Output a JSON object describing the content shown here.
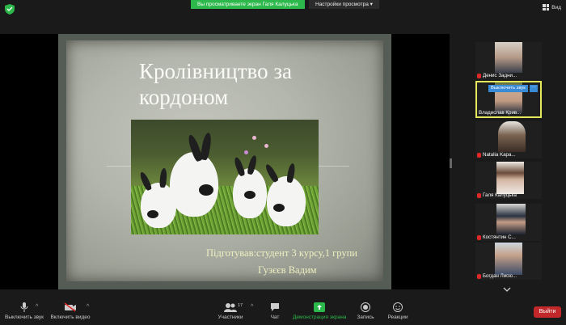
{
  "topbar": {
    "banner_text": "Вы просматриваете экран Галя Калуцька",
    "view_options_label": "Настройки просмотра",
    "view_options_caret": "▾",
    "view_button_label": "Вид"
  },
  "slide": {
    "title": "Кролівництво за кордоном",
    "author_line1": "Підготував:студент 3 курсу,1 групи",
    "author_line2": "Гузєєв Вадим"
  },
  "gallery": {
    "participants": [
      {
        "name": "Денис Задни...",
        "muted": true
      },
      {
        "name": "Владислав Крив...",
        "muted": true,
        "active": true,
        "overlay": "Выключить звук",
        "more": "···"
      },
      {
        "name": "Natalia Kapa...",
        "muted": true
      },
      {
        "name": "Галя Калуцька",
        "muted": true
      },
      {
        "name": "Костянтин С...",
        "muted": true
      },
      {
        "name": "Богдан Лисю...",
        "muted": true
      }
    ]
  },
  "toolbar": {
    "mute_label": "Выключить звук",
    "video_label": "Включить видео",
    "participants_label": "Участники",
    "participants_count": "17",
    "chat_label": "Чат",
    "share_label": "Демонстрация экрана",
    "record_label": "Запись",
    "reactions_label": "Реакции",
    "leave_label": "Выйти",
    "caret": "^"
  },
  "colors": {
    "share_green": "#2db84b",
    "active_border": "#e5e85a",
    "leave_red": "#c2272a",
    "overlay_blue": "#3a8bd6"
  }
}
